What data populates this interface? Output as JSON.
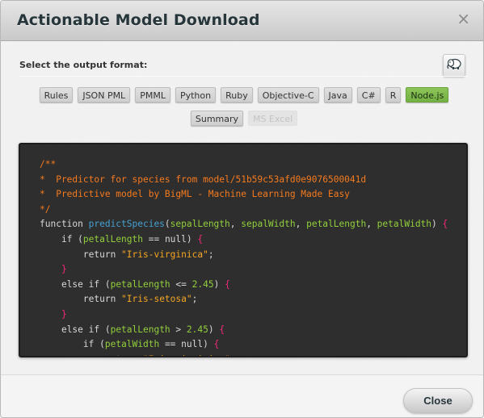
{
  "dialog": {
    "title": "Actionable Model Download",
    "close_icon": "×"
  },
  "body": {
    "select_label": "Select the output format:",
    "hadoop_button_icon": "hadoop-elephant-icon",
    "formats": [
      {
        "label": "Rules",
        "state": "normal"
      },
      {
        "label": "JSON PML",
        "state": "normal"
      },
      {
        "label": "PMML",
        "state": "normal"
      },
      {
        "label": "Python",
        "state": "normal"
      },
      {
        "label": "Ruby",
        "state": "normal"
      },
      {
        "label": "Objective-C",
        "state": "normal"
      },
      {
        "label": "Java",
        "state": "normal"
      },
      {
        "label": "C#",
        "state": "normal"
      },
      {
        "label": "R",
        "state": "normal"
      },
      {
        "label": "Node.js",
        "state": "active"
      },
      {
        "label": "Summary",
        "state": "normal"
      },
      {
        "label": "MS Excel",
        "state": "disabled"
      }
    ],
    "selected_format": "Node.js",
    "code": {
      "language": "javascript",
      "lines": [
        {
          "indent": 0,
          "tokens": [
            {
              "t": "/**",
              "c": "com"
            }
          ]
        },
        {
          "indent": 0,
          "tokens": [
            {
              "t": "*  Predictor for species from model/51b59c53afd0e9076500041d",
              "c": "com"
            }
          ]
        },
        {
          "indent": 0,
          "tokens": [
            {
              "t": "*  Predictive model by BigML - Machine Learning Made Easy",
              "c": "com"
            }
          ]
        },
        {
          "indent": 0,
          "tokens": [
            {
              "t": "*/",
              "c": "com"
            }
          ]
        },
        {
          "indent": 0,
          "tokens": [
            {
              "t": "function ",
              "c": "kw"
            },
            {
              "t": "predictSpecies",
              "c": "fn"
            },
            {
              "t": "(",
              "c": "kw"
            },
            {
              "t": "sepalLength",
              "c": "var"
            },
            {
              "t": ", ",
              "c": "kw"
            },
            {
              "t": "sepalWidth",
              "c": "var"
            },
            {
              "t": ", ",
              "c": "kw"
            },
            {
              "t": "petalLength",
              "c": "var"
            },
            {
              "t": ", ",
              "c": "kw"
            },
            {
              "t": "petalWidth",
              "c": "var"
            },
            {
              "t": ") ",
              "c": "kw"
            },
            {
              "t": "{",
              "c": "br"
            }
          ]
        },
        {
          "indent": 1,
          "tokens": [
            {
              "t": "if (",
              "c": "kw"
            },
            {
              "t": "petalLength",
              "c": "var"
            },
            {
              "t": " == null) ",
              "c": "kw"
            },
            {
              "t": "{",
              "c": "br"
            }
          ]
        },
        {
          "indent": 2,
          "tokens": [
            {
              "t": "return ",
              "c": "kw"
            },
            {
              "t": "\"Iris-virginica\"",
              "c": "str"
            },
            {
              "t": ";",
              "c": "kw"
            }
          ]
        },
        {
          "indent": 1,
          "tokens": [
            {
              "t": "}",
              "c": "br"
            }
          ]
        },
        {
          "indent": 1,
          "tokens": [
            {
              "t": "else if (",
              "c": "kw"
            },
            {
              "t": "petalLength",
              "c": "var"
            },
            {
              "t": " <= ",
              "c": "kw"
            },
            {
              "t": "2.45",
              "c": "num"
            },
            {
              "t": ") ",
              "c": "kw"
            },
            {
              "t": "{",
              "c": "br"
            }
          ]
        },
        {
          "indent": 2,
          "tokens": [
            {
              "t": "return ",
              "c": "kw"
            },
            {
              "t": "\"Iris-setosa\"",
              "c": "str"
            },
            {
              "t": ";",
              "c": "kw"
            }
          ]
        },
        {
          "indent": 1,
          "tokens": [
            {
              "t": "}",
              "c": "br"
            }
          ]
        },
        {
          "indent": 1,
          "tokens": [
            {
              "t": "else if (",
              "c": "kw"
            },
            {
              "t": "petalLength",
              "c": "var"
            },
            {
              "t": " > ",
              "c": "kw"
            },
            {
              "t": "2.45",
              "c": "num"
            },
            {
              "t": ") ",
              "c": "kw"
            },
            {
              "t": "{",
              "c": "br"
            }
          ]
        },
        {
          "indent": 2,
          "tokens": [
            {
              "t": "if (",
              "c": "kw"
            },
            {
              "t": "petalWidth",
              "c": "var"
            },
            {
              "t": " == null) ",
              "c": "kw"
            },
            {
              "t": "{",
              "c": "br"
            }
          ]
        },
        {
          "indent": 3,
          "tokens": [
            {
              "t": "return ",
              "c": "kw"
            },
            {
              "t": "\"Iris-virginica\"",
              "c": "str"
            },
            {
              "t": ";",
              "c": "kw"
            }
          ]
        }
      ]
    }
  },
  "footer": {
    "close_label": "Close"
  }
}
